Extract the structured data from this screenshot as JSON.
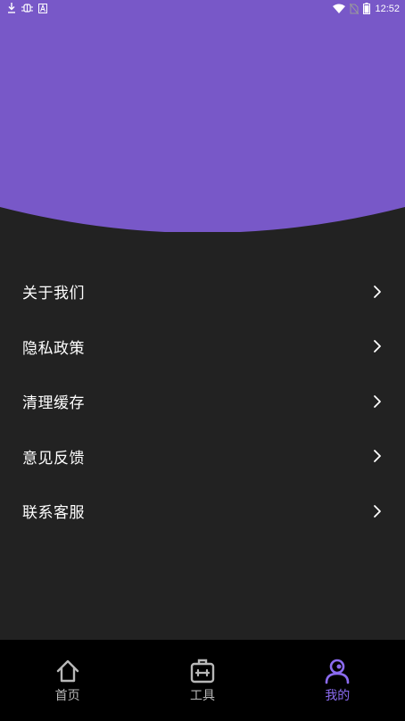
{
  "status_bar": {
    "time": "12:52",
    "left_icons": [
      "download-icon",
      "bug-icon",
      "a-icon"
    ],
    "right_icons": [
      "wifi-icon",
      "no-sim-icon",
      "battery-icon"
    ]
  },
  "theme": {
    "accent": "#7858c8",
    "background": "#222222",
    "tabbar_background": "#000000",
    "active_tab_color": "#8b6bf0"
  },
  "menu": {
    "items": [
      {
        "label": "关于我们"
      },
      {
        "label": "隐私政策"
      },
      {
        "label": "清理缓存"
      },
      {
        "label": "意见反馈"
      },
      {
        "label": "联系客服"
      }
    ]
  },
  "tabbar": {
    "tabs": [
      {
        "label": "首页",
        "icon": "home-icon",
        "active": false
      },
      {
        "label": "工具",
        "icon": "toolbox-icon",
        "active": false
      },
      {
        "label": "我的",
        "icon": "profile-icon",
        "active": true
      }
    ]
  }
}
